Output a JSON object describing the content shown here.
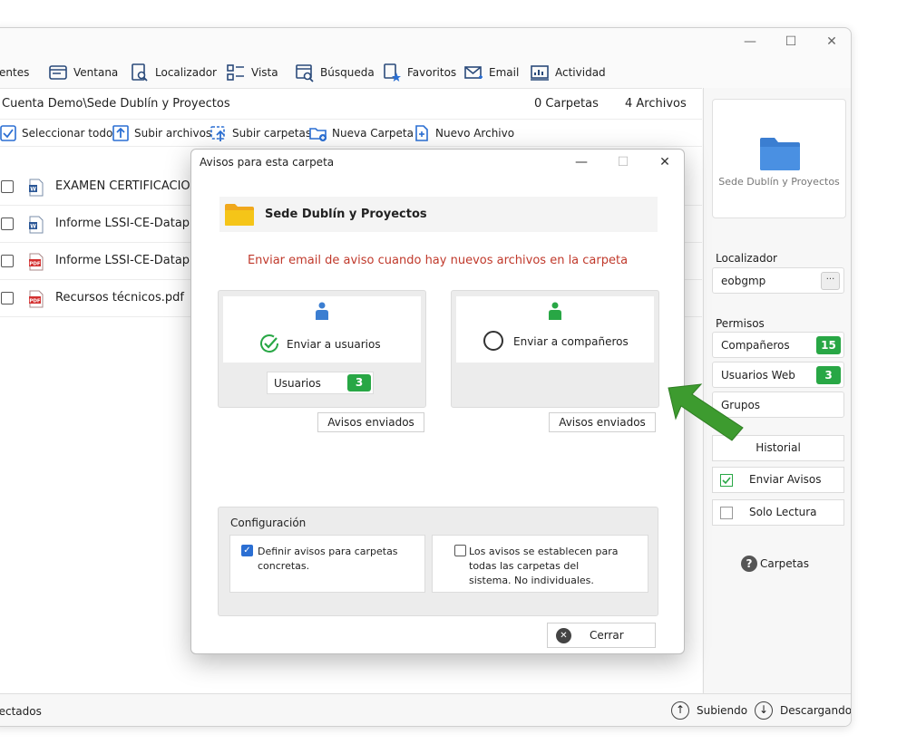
{
  "window": {
    "controls": {
      "minimize": "—",
      "maximize": "☐",
      "close": "✕"
    }
  },
  "menu": [
    {
      "label": "entes",
      "icon": "clients-icon"
    },
    {
      "label": "Ventana",
      "icon": "window-icon"
    },
    {
      "label": "Localizador",
      "icon": "locator-icon"
    },
    {
      "label": "Vista",
      "icon": "view-icon"
    },
    {
      "label": "Búsqueda",
      "icon": "search-icon"
    },
    {
      "label": "Favoritos",
      "icon": "favorites-icon"
    },
    {
      "label": "Email",
      "icon": "email-icon"
    },
    {
      "label": "Actividad",
      "icon": "activity-icon"
    }
  ],
  "path": {
    "text": "Cuenta Demo\\Sede Dublín y Proyectos",
    "folders": "0 Carpetas",
    "files": "4 Archivos"
  },
  "actions": [
    {
      "label": "Seleccionar todo",
      "icon": "select-all-icon"
    },
    {
      "label": "Subir archivos",
      "icon": "upload-files-icon"
    },
    {
      "label": "Subir carpetas",
      "icon": "upload-folders-icon"
    },
    {
      "label": "Nueva Carpeta",
      "icon": "new-folder-icon"
    },
    {
      "label": "Nuevo Archivo",
      "icon": "new-file-icon"
    }
  ],
  "files": [
    {
      "name": "EXAMEN CERTIFICACIONE",
      "type": "word"
    },
    {
      "name": "Informe LSSI-CE-Dataprius",
      "type": "word"
    },
    {
      "name": "Informe LSSI-CE-Dataprius",
      "type": "pdf"
    },
    {
      "name": "Recursos técnicos.pdf",
      "type": "pdf"
    }
  ],
  "side": {
    "preview_name": "Sede Dublín y Proyectos",
    "locator_label": "Localizador",
    "locator_value": "eobgmp",
    "locator_more": "···",
    "permisos_label": "Permisos",
    "companeros": "Compañeros",
    "companeros_count": "15",
    "usuarios_web": "Usuarios Web",
    "usuarios_web_count": "3",
    "grupos": "Grupos",
    "historial": "Historial",
    "enviar_avisos": "Enviar Avisos",
    "solo_lectura": "Solo Lectura",
    "help_glyph": "?",
    "carpetas": "Carpetas"
  },
  "status": {
    "left": "nectados",
    "uploading": "Subiendo",
    "downloading": "Descargando",
    "up_glyph": "↑",
    "down_glyph": "↓"
  },
  "dialog": {
    "title": "Avisos para esta carpeta",
    "controls": {
      "minimize": "—",
      "maximize": "☐",
      "close": "✕"
    },
    "folder_name": "Sede Dublín y Proyectos",
    "notice": "Enviar email de aviso cuando hay nuevos archivos en la carpeta",
    "users_option": "Enviar a usuarios",
    "partners_option": "Enviar a compañeros",
    "users_field_label": "Usuarios",
    "users_field_count": "3",
    "sent_left": "Avisos enviados",
    "sent_right": "Avisos enviados",
    "config_title": "Configuración",
    "config_check_glyph": "✓",
    "config_left": "Definir avisos para carpetas concretas.",
    "config_right": "Los avisos se establecen para todas las carpetas del sistema. No individuales.",
    "close_glyph": "✕",
    "close_label": "Cerrar"
  },
  "colors": {
    "accent_blue": "#2b6fd3",
    "badge_green": "#28a745",
    "notice_red": "#c0392b",
    "arrow_green": "#3d9b2f",
    "folder_yellow": "#f5c518"
  }
}
